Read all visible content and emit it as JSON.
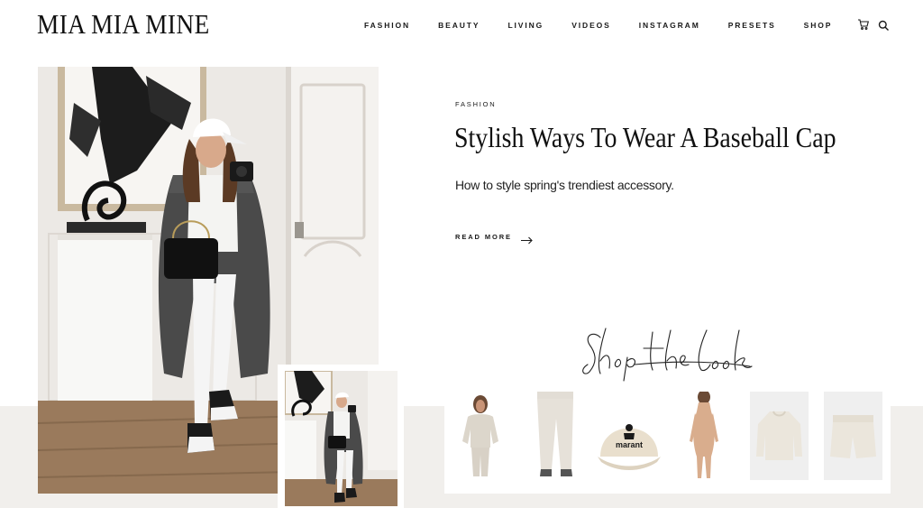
{
  "site": {
    "logo": "MIA MIA MINE"
  },
  "nav": {
    "items": [
      "FASHION",
      "BEAUTY",
      "LIVING",
      "VIDEOS",
      "INSTAGRAM",
      "PRESETS",
      "SHOP"
    ],
    "cart_icon": "cart-icon",
    "search_icon": "search-icon"
  },
  "article": {
    "category": "FASHION",
    "title": "Stylish Ways To Wear A Baseball Cap",
    "excerpt": "How to style spring's trendiest accessory.",
    "read_more": "READ MORE",
    "read_more_icon": "arrow-right-icon"
  },
  "shop_the_look": {
    "heading": "Shop the look",
    "products": [
      {
        "name": "hooded-sweatshirt-set"
      },
      {
        "name": "jogger-pants"
      },
      {
        "name": "baseball-cap",
        "text": "marant"
      },
      {
        "name": "bodysuit"
      },
      {
        "name": "knit-sweater"
      },
      {
        "name": "knit-shorts"
      }
    ]
  },
  "colors": {
    "text": "#1a1a1a",
    "band": "#f1efec",
    "panel": "#ffffff"
  }
}
